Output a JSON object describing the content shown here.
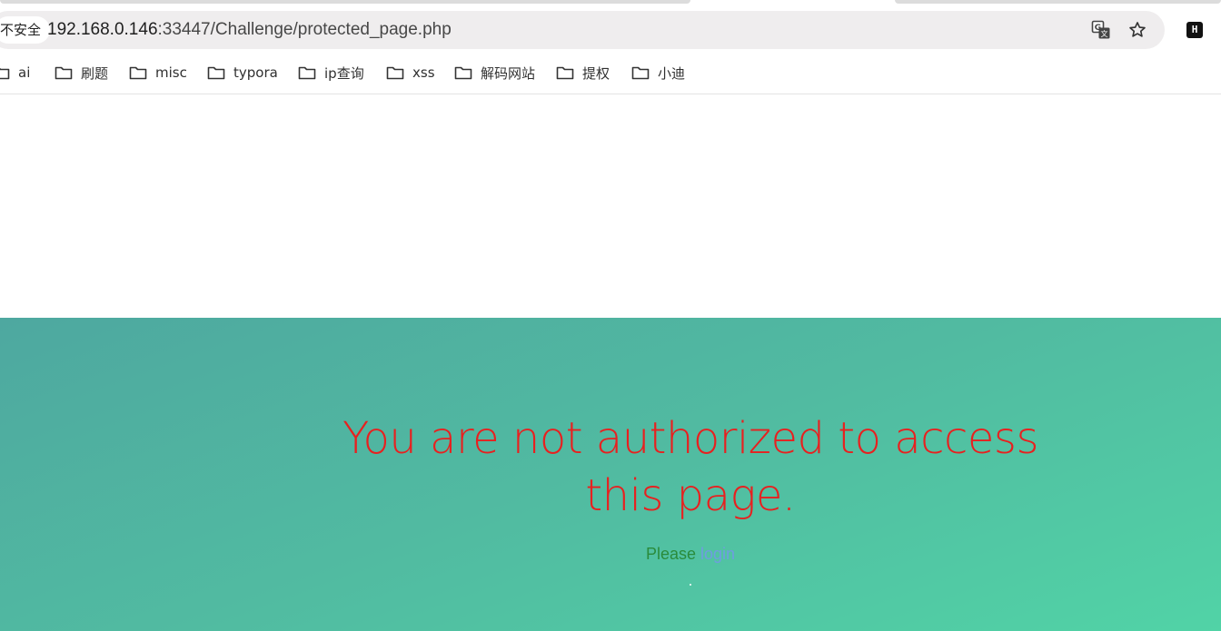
{
  "browser": {
    "security_chip": "不安全",
    "url": {
      "host": "192.168.0.146",
      "rest": ":33447/Challenge/protected_page.php"
    },
    "icons": {
      "translate": "translate-icon",
      "bookmark_star": "star-icon",
      "extension": "extension-h-icon"
    },
    "extension_label": "H"
  },
  "bookmarks": [
    {
      "label": "ai"
    },
    {
      "label": "刷题"
    },
    {
      "label": "misc"
    },
    {
      "label": "typora"
    },
    {
      "label": "ip查询"
    },
    {
      "label": "xss"
    },
    {
      "label": "解码网站"
    },
    {
      "label": "提权"
    },
    {
      "label": "小迪"
    }
  ],
  "page": {
    "message": "You are not authorized to access this page.",
    "please_text": "Please",
    "login_link": "login",
    "colors": {
      "message": "#e8201f",
      "please": "#2a8b3b",
      "link": "#6f9de0",
      "gradient_start": "#4ea8a0",
      "gradient_end": "#51d3a6"
    }
  }
}
